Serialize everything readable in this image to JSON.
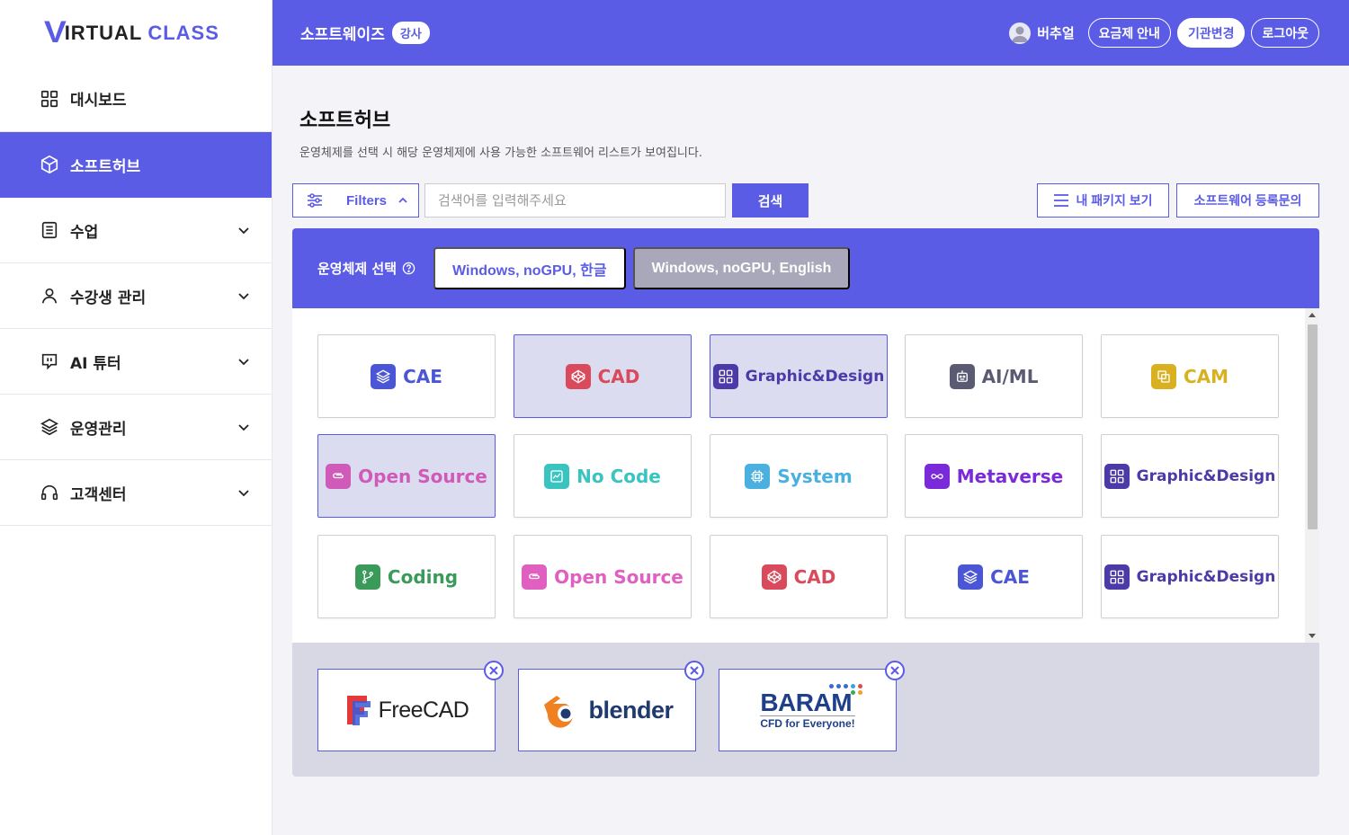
{
  "sidebar": {
    "logo": {
      "v": "V",
      "main": "IRTUAL",
      "accent": "CLASS"
    },
    "items": [
      {
        "label": "대시보드",
        "icon": "grid-icon",
        "active": false,
        "expandable": false
      },
      {
        "label": "소프트허브",
        "icon": "cube-icon",
        "active": true,
        "expandable": false
      },
      {
        "label": "수업",
        "icon": "book-icon",
        "active": false,
        "expandable": true
      },
      {
        "label": "수강생 관리",
        "icon": "user-icon",
        "active": false,
        "expandable": true
      },
      {
        "label": "AI 튜터",
        "icon": "chat-icon",
        "active": false,
        "expandable": true
      },
      {
        "label": "운영관리",
        "icon": "layers-icon",
        "active": false,
        "expandable": true
      },
      {
        "label": "고객센터",
        "icon": "headset-icon",
        "active": false,
        "expandable": true
      }
    ]
  },
  "header": {
    "org_name": "소프트웨이즈",
    "role": "강사",
    "user_name": "버추얼",
    "pricing_label": "요금제 안내",
    "switch_org_label": "기관변경",
    "logout_label": "로그아웃"
  },
  "main": {
    "title": "소프트허브",
    "description": "운영체제를 선택 시 해당 운영체제에 사용 가능한 소프트웨어 리스트가 보여집니다.",
    "filters_label": "Filters",
    "search_placeholder": "검색어를 입력해주세요",
    "search_button": "검색",
    "my_package_button": "내 패키지 보기",
    "inquiry_button": "소프트웨어 등록문의",
    "os_select_label": "운영체제 선택",
    "os_options": [
      {
        "label": "Windows, noGPU, 한글",
        "selected": true
      },
      {
        "label": "Windows, noGPU, English",
        "selected": false
      }
    ],
    "categories": [
      {
        "label": "CAE",
        "color": "#4a56d6",
        "icon": "layers-icon",
        "selected": false
      },
      {
        "label": "CAD",
        "color": "#d84a5c",
        "icon": "codepen-icon",
        "selected": true
      },
      {
        "label": "Graphic&Design",
        "color": "#4b3aa8",
        "icon": "grid-icon",
        "selected": true
      },
      {
        "label": "AI/ML",
        "color": "#5a5a72",
        "icon": "robot-icon",
        "selected": false
      },
      {
        "label": "CAM",
        "color": "#d8b020",
        "icon": "copy-icon",
        "selected": false
      },
      {
        "label": "Open Source",
        "color": "#d05ab8",
        "icon": "paperclip-icon",
        "selected": true
      },
      {
        "label": "No Code",
        "color": "#3ac4c0",
        "icon": "chart-icon",
        "selected": false
      },
      {
        "label": "System",
        "color": "#4ab0e0",
        "icon": "cpu-icon",
        "selected": false
      },
      {
        "label": "Metaverse",
        "color": "#7a2ad8",
        "icon": "infinity-icon",
        "selected": false
      },
      {
        "label": "Graphic&Design",
        "color": "#4b3aa8",
        "icon": "grid-icon",
        "selected": false
      },
      {
        "label": "Coding",
        "color": "#3a9a5a",
        "icon": "git-branch-icon",
        "selected": false
      },
      {
        "label": "Open Source",
        "color": "#e060c0",
        "icon": "paperclip-icon",
        "selected": false
      },
      {
        "label": "CAD",
        "color": "#d84a5c",
        "icon": "codepen-icon",
        "selected": false
      },
      {
        "label": "CAE",
        "color": "#4a56d6",
        "icon": "layers-icon",
        "selected": false
      },
      {
        "label": "Graphic&Design",
        "color": "#4b3aa8",
        "icon": "grid-icon",
        "selected": false
      }
    ],
    "packages": [
      {
        "name": "FreeCAD",
        "logo": "freecad-logo"
      },
      {
        "name": "blender",
        "logo": "blender-logo"
      },
      {
        "name": "BARAM",
        "tagline": "CFD for Everyone!",
        "logo": "baram-logo"
      }
    ]
  },
  "colors": {
    "accent": "#5b5ce6",
    "selected_bg": "#dcdcf0",
    "disabled": "#a8a8ba"
  }
}
